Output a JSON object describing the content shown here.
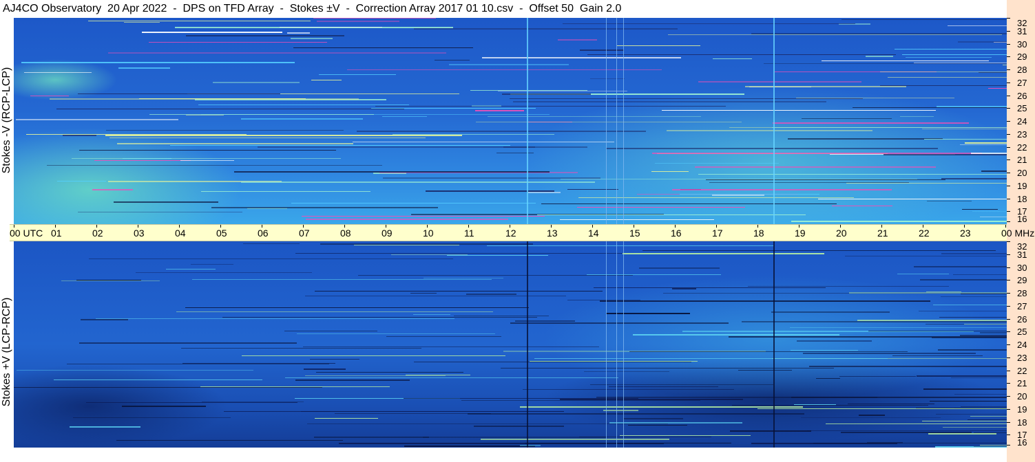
{
  "title": "AJ4CO Observatory  20 Apr 2022  -  DPS on TFD Array  -  Stokes ±V  -  Correction Array 2017 01 10.csv  -  Offset 50  Gain 2.0",
  "panels": {
    "top": {
      "ylabel": "Stokes -V (RCP-LCP)"
    },
    "bottom": {
      "ylabel": "Stokes +V (LCP-RCP)"
    }
  },
  "time_axis": {
    "labels": [
      "00 UTC",
      "01",
      "02",
      "03",
      "04",
      "05",
      "06",
      "07",
      "08",
      "09",
      "10",
      "11",
      "12",
      "13",
      "14",
      "15",
      "16",
      "17",
      "18",
      "19",
      "20",
      "21",
      "22",
      "23",
      "00 MHz"
    ]
  },
  "freq_axis": {
    "labels": [
      "32",
      "31",
      "30",
      "29",
      "28",
      "27",
      "26",
      "25",
      "24",
      "23",
      "22",
      "21",
      "20",
      "19",
      "18",
      "17",
      "16"
    ]
  },
  "colors": {
    "top_base": "#2a6fd6",
    "bottom_base": "#1f55c4",
    "axis_band": "#ffffcc",
    "right_strip": "#ffe3cc"
  }
}
